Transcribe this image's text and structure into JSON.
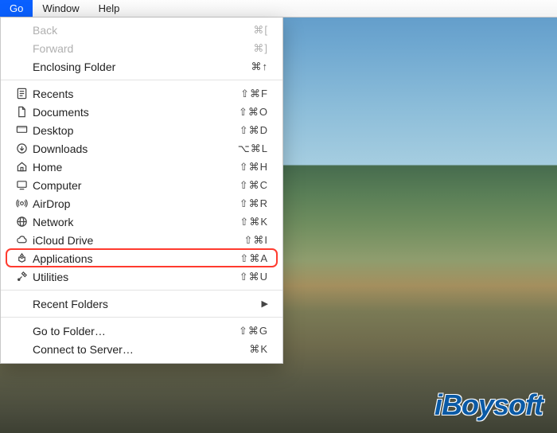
{
  "menubar": {
    "go": "Go",
    "window": "Window",
    "help": "Help"
  },
  "menu": {
    "back": {
      "label": "Back",
      "shortcut": "⌘["
    },
    "forward": {
      "label": "Forward",
      "shortcut": "⌘]"
    },
    "enclosing": {
      "label": "Enclosing Folder",
      "shortcut": "⌘↑"
    },
    "recents": {
      "label": "Recents",
      "shortcut": "⇧⌘F"
    },
    "documents": {
      "label": "Documents",
      "shortcut": "⇧⌘O"
    },
    "desktop": {
      "label": "Desktop",
      "shortcut": "⇧⌘D"
    },
    "downloads": {
      "label": "Downloads",
      "shortcut": "⌥⌘L"
    },
    "home": {
      "label": "Home",
      "shortcut": "⇧⌘H"
    },
    "computer": {
      "label": "Computer",
      "shortcut": "⇧⌘C"
    },
    "airdrop": {
      "label": "AirDrop",
      "shortcut": "⇧⌘R"
    },
    "network": {
      "label": "Network",
      "shortcut": "⇧⌘K"
    },
    "icloud": {
      "label": "iCloud Drive",
      "shortcut": "⇧⌘I"
    },
    "applications": {
      "label": "Applications",
      "shortcut": "⇧⌘A"
    },
    "utilities": {
      "label": "Utilities",
      "shortcut": "⇧⌘U"
    },
    "recentfolders": {
      "label": "Recent Folders"
    },
    "gotofolder": {
      "label": "Go to Folder…",
      "shortcut": "⇧⌘G"
    },
    "connect": {
      "label": "Connect to Server…",
      "shortcut": "⌘K"
    }
  },
  "watermark": "iBoysoft"
}
